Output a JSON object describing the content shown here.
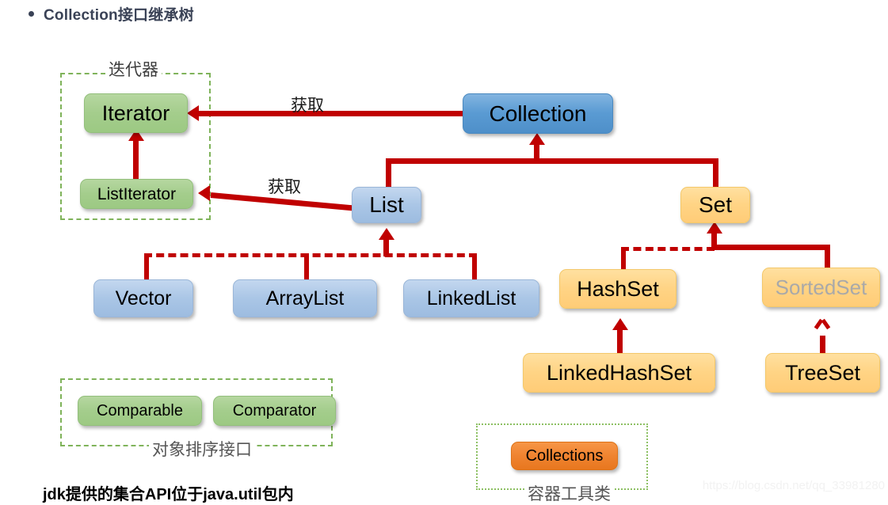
{
  "heading": {
    "text": "Collection接口继承树"
  },
  "groups": {
    "iterator": {
      "caption": "迭代器"
    },
    "sorting": {
      "caption": "对象排序接口"
    },
    "utility": {
      "caption": "容器工具类"
    }
  },
  "nodes": {
    "iterator": "Iterator",
    "list_iterator": "ListIterator",
    "collection": "Collection",
    "list": "List",
    "set": "Set",
    "vector": "Vector",
    "arraylist": "ArrayList",
    "linkedlist": "LinkedList",
    "hashset": "HashSet",
    "sortedset": "SortedSet",
    "linkedhashset": "LinkedHashSet",
    "treeset": "TreeSet",
    "comparable": "Comparable",
    "comparator": "Comparator",
    "collections": "Collections"
  },
  "edge_labels": {
    "collection_to_iterator": "获取",
    "list_to_listiterator": "获取"
  },
  "footnote": {
    "text": "jdk提供的集合API位于java.util包内"
  },
  "watermark": {
    "text": "https://blog.csdn.net/qq_33981280"
  },
  "colors": {
    "connector": "#c00000",
    "frame_green": "#7fb35a",
    "blue_dark": "#5a9bd3",
    "blue_light": "#aac6e6",
    "amber": "#ffd485",
    "green": "#a4cd8c",
    "orange": "#ef8330",
    "muted": "#a9a9a9",
    "heading": "#3a4256"
  }
}
